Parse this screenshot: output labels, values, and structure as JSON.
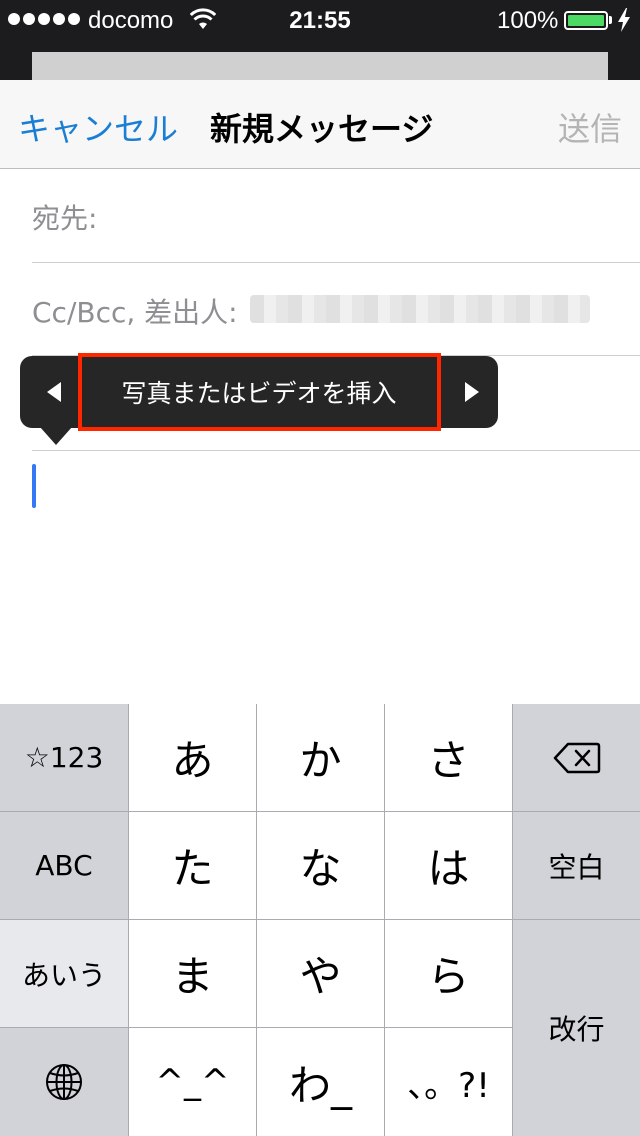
{
  "status_bar": {
    "carrier": "docomo",
    "time": "21:55",
    "battery_percent": "100%",
    "battery_level": 1.0,
    "battery_color": "#4cd964"
  },
  "nav": {
    "cancel_label": "キャンセル",
    "title": "新規メッセージ",
    "send_label": "送信"
  },
  "compose": {
    "to_label": "宛先:",
    "cc_label": "Cc/Bcc, 差出人:"
  },
  "edit_menu": {
    "prev_icon": "triangle-left-icon",
    "next_icon": "triangle-right-icon",
    "item_label": "写真またはビデオを挿入",
    "highlight_color": "#ff2600"
  },
  "keyboard": {
    "symbols_key": "☆123",
    "abc_key": "ABC",
    "kana_mode_key": "あいう",
    "globe_icon": "globe-icon",
    "delete_icon": "delete-backspace-icon",
    "keys_row1": [
      "あ",
      "か",
      "さ"
    ],
    "keys_row2": [
      "た",
      "な",
      "は"
    ],
    "keys_row3": [
      "ま",
      "や",
      "ら"
    ],
    "emoticon_key": "^_^",
    "wa_key": "わ_",
    "punct_key": "、。?!",
    "space_key": "空白",
    "return_key": "改行"
  },
  "colors": {
    "accent": "#1a7fd4",
    "cursor": "#3478f6"
  }
}
